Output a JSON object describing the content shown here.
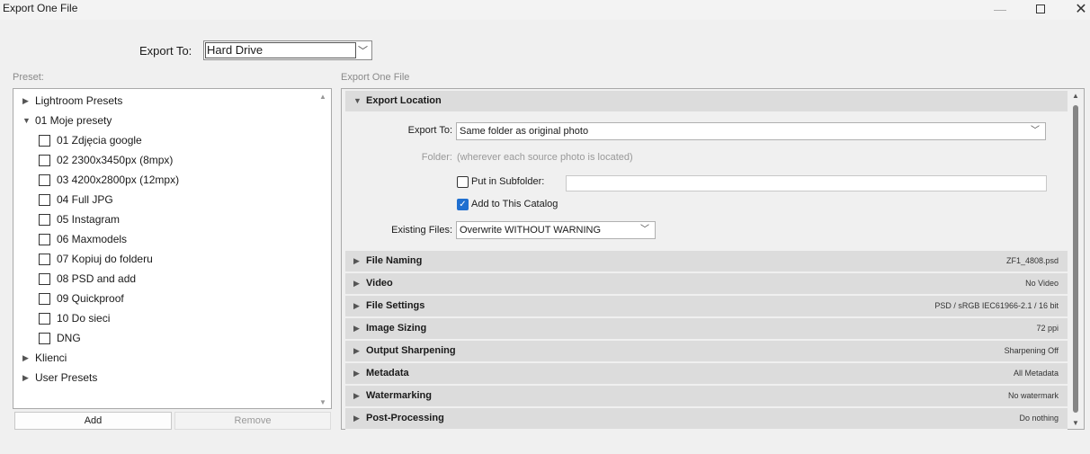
{
  "window": {
    "title": "Export One File"
  },
  "export_to": {
    "label": "Export To:",
    "value": "Hard Drive"
  },
  "preset": {
    "label": "Preset:",
    "items": [
      {
        "label": "Lightroom Presets",
        "type": "folder-collapsed"
      },
      {
        "label": "01 Moje presety",
        "type": "folder-expanded"
      },
      {
        "label": "01 Zdjęcia google",
        "type": "preset"
      },
      {
        "label": "02 2300x3450px (8mpx)",
        "type": "preset"
      },
      {
        "label": "03 4200x2800px (12mpx)",
        "type": "preset"
      },
      {
        "label": "04 Full JPG",
        "type": "preset"
      },
      {
        "label": "05 Instagram",
        "type": "preset"
      },
      {
        "label": "06 Maxmodels",
        "type": "preset"
      },
      {
        "label": "07 Kopiuj do folderu",
        "type": "preset"
      },
      {
        "label": "08 PSD and add",
        "type": "preset"
      },
      {
        "label": "09 Quickproof",
        "type": "preset"
      },
      {
        "label": "10 Do sieci",
        "type": "preset"
      },
      {
        "label": "DNG",
        "type": "preset"
      },
      {
        "label": "Klienci",
        "type": "folder-collapsed"
      },
      {
        "label": "User Presets",
        "type": "folder-collapsed"
      }
    ],
    "add_label": "Add",
    "remove_label": "Remove"
  },
  "panel": {
    "label": "Export One File",
    "export_location": {
      "title": "Export Location",
      "export_to_label": "Export To:",
      "export_to_value": "Same folder as original photo",
      "folder_label": "Folder:",
      "folder_value": "(wherever each source photo is located)",
      "subfolder_label": "Put in Subfolder:",
      "subfolder_checked": false,
      "subfolder_value": "",
      "catalog_label": "Add to This Catalog",
      "catalog_checked": true,
      "existing_label": "Existing Files:",
      "existing_value": "Overwrite WITHOUT WARNING"
    },
    "sections": [
      {
        "title": "File Naming",
        "summary": "ZF1_4808.psd"
      },
      {
        "title": "Video",
        "summary": "No Video"
      },
      {
        "title": "File Settings",
        "summary": "PSD / sRGB IEC61966-2.1 / 16 bit"
      },
      {
        "title": "Image Sizing",
        "summary": "72 ppi"
      },
      {
        "title": "Output Sharpening",
        "summary": "Sharpening Off"
      },
      {
        "title": "Metadata",
        "summary": "All Metadata"
      },
      {
        "title": "Watermarking",
        "summary": "No watermark"
      },
      {
        "title": "Post-Processing",
        "summary": "Do nothing"
      }
    ]
  },
  "colors": {
    "accent": "#1f6fd0",
    "section_header": "#dcdcdc",
    "window_bg": "#f0f0f0"
  }
}
